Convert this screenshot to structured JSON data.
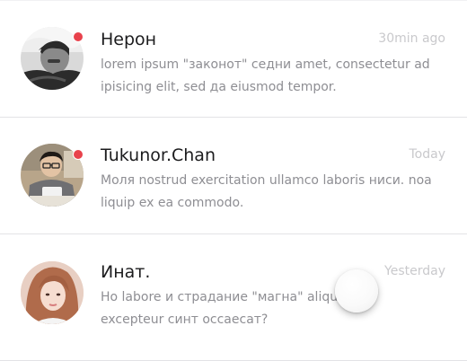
{
  "conversations": [
    {
      "name": "Нерон",
      "time": "30min ago",
      "preview_line1": "lorem ipsum \"законот\" седни amet, consectetur ad",
      "preview_line2": "ipisicing elit, sed да eiusmod tempor.",
      "unread": true,
      "avatar": "avatar-photo-bw-man"
    },
    {
      "name": "Tukunor.Chan",
      "time": "Today",
      "preview_line1": "Моля nostrud exercitation ullamco laboris ниси. noa",
      "preview_line2": "liquip ex ea commodo.",
      "unread": true,
      "avatar": "avatar-photo-man-glasses"
    },
    {
      "name": "Инат.",
      "time": "Yesterday",
      "preview_line1": "Но labore и страдание \"магна\" aliqua.",
      "preview_line2": "excepteur синт оссаесат?",
      "unread": false,
      "avatar": "avatar-photo-woman"
    }
  ],
  "colors": {
    "unread_dot": "#e8424c",
    "name_text": "#1c1c1e",
    "preview_text": "#8e8e93",
    "time_text": "#c9c9cc",
    "background": "#f1f1f3"
  },
  "floating_button": {
    "icon": "floating-action-circle"
  }
}
